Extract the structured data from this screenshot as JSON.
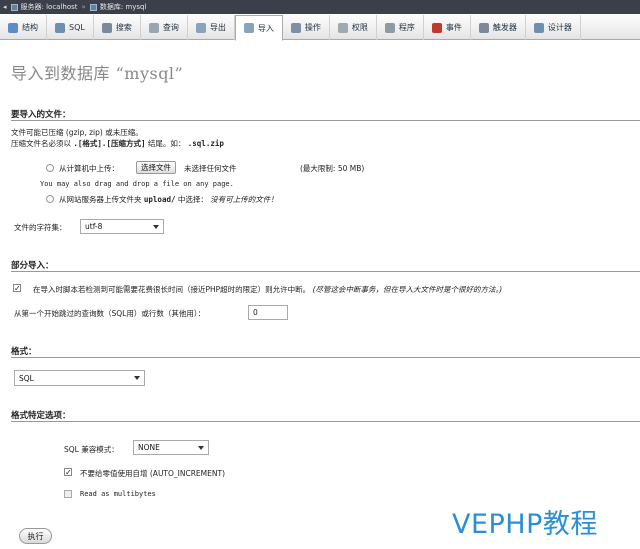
{
  "topbar": {
    "server_label": "服务器: localhost",
    "db_label": "数据库: mysql"
  },
  "tabs": [
    {
      "label": "结构",
      "icon": "structure-icon",
      "color": "#5b8ec9"
    },
    {
      "label": "SQL",
      "icon": "sql-icon",
      "color": "#6c8fb3"
    },
    {
      "label": "搜索",
      "icon": "search-icon",
      "color": "#7a8a99"
    },
    {
      "label": "查询",
      "icon": "query-icon",
      "color": "#9aa5b1"
    },
    {
      "label": "导出",
      "icon": "export-icon",
      "color": "#8aa3bd"
    },
    {
      "label": "导入",
      "icon": "import-icon",
      "color": "#8aa3bd",
      "active": true
    },
    {
      "label": "操作",
      "icon": "wrench-icon",
      "color": "#7d8fa3"
    },
    {
      "label": "权限",
      "icon": "privileges-icon",
      "color": "#a0a8b0"
    },
    {
      "label": "程序",
      "icon": "routines-icon",
      "color": "#909aa5"
    },
    {
      "label": "事件",
      "icon": "events-icon",
      "color": "#c0392b"
    },
    {
      "label": "触发器",
      "icon": "triggers-icon",
      "color": "#7a8a99"
    },
    {
      "label": "设计器",
      "icon": "designer-icon",
      "color": "#6f8fb0"
    }
  ],
  "page_title": "导入到数据库 “mysql”",
  "file_section": {
    "heading": "要导入的文件：",
    "line1": "文件可能已压缩 (gzip, zip) 或未压缩。",
    "line2_prefix": "压缩文件名必须以",
    "line2_bold": ".[格式].[压缩方式]",
    "line2_mid": "结尾。如：",
    "line2_example": ".sql.zip",
    "upload_label": "从计算机中上传：",
    "choose_button": "选择文件",
    "no_file": "未选择任何文件",
    "max_size": "(最大限制: 50 MB)",
    "drag_hint": "You may also drag and drop a file on any page.",
    "server_upload_prefix": "从网站服务器上传文件夹",
    "server_upload_dir": "upload/",
    "server_upload_mid": "中选择：",
    "server_upload_none": "没有可上传的文件！",
    "charset_label": "文件的字符集：",
    "charset_value": "utf-8"
  },
  "partial_section": {
    "heading": "部分导入：",
    "allow_interrupt": "在导入时脚本若检测到可能需要花费很长时间（接近PHP超时的限定）则允许中断。",
    "allow_interrupt_note": "(尽管这会中断事务，但在导入大文件时是个很好的方法。)",
    "skip_label": "从第一个开始跳过的查询数（SQL用）或行数（其他用）：",
    "skip_value": "0"
  },
  "format_section": {
    "heading": "格式：",
    "format_value": "SQL"
  },
  "options_section": {
    "heading": "格式特定选项：",
    "compat_label": "SQL 兼容模式：",
    "compat_value": "NONE",
    "no_auto_value": "不要给零值使用自增 (AUTO_INCREMENT)",
    "multibytes": "Read as multibytes"
  },
  "go_button": "执行",
  "watermark": "VEPHP教程"
}
